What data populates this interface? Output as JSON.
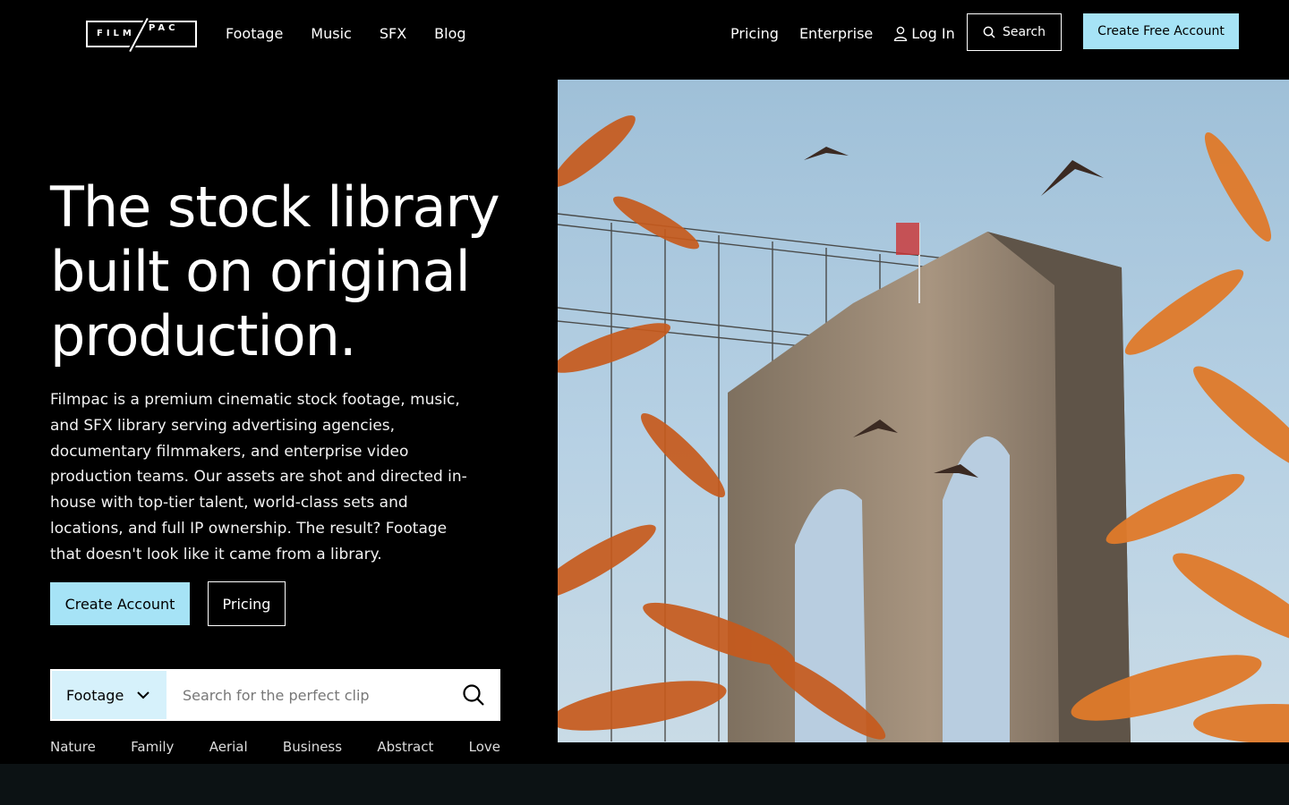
{
  "brand": {
    "logo_left": "FILM",
    "logo_right": "PAC"
  },
  "nav": {
    "primary": [
      "Footage",
      "Music",
      "SFX",
      "Blog"
    ],
    "secondary": {
      "pricing": "Pricing",
      "enterprise": "Enterprise",
      "login": "Log In"
    },
    "search_label": "Search",
    "create_free_label": "Create Free Account"
  },
  "hero": {
    "headline": "The stock library built on original production.",
    "intro": "Filmpac is a premium cinematic stock footage, music, and SFX library serving advertising agencies, documentary filmmakers, and enterprise video production teams. Our assets are shot and directed in-house with top-tier talent, world-class sets and locations, and full IP ownership. The result? Footage that doesn't look like it came from a library.",
    "create_account_label": "Create Account",
    "pricing_label": "Pricing"
  },
  "search": {
    "category": "Footage",
    "placeholder": "Search for the perfect clip",
    "value": ""
  },
  "tags": [
    "Nature",
    "Family",
    "Aerial",
    "Business",
    "Abstract",
    "Love"
  ],
  "colors": {
    "accent": "#a6e3f6",
    "select_bg": "#d6f1fb",
    "background": "#000000",
    "bottom_band": "#0c1214"
  },
  "icons": {
    "login": "user-icon",
    "search": "search-icon",
    "dropdown": "chevron-down-icon"
  }
}
